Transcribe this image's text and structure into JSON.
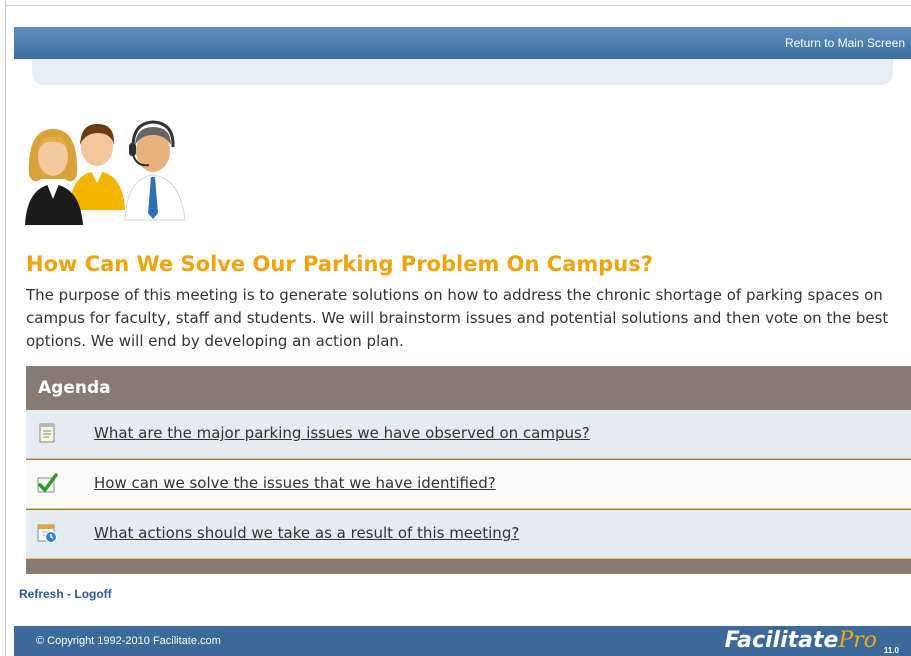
{
  "header": {
    "return_link": "Return to Main Screen"
  },
  "meeting": {
    "title": "How Can We Solve Our Parking Problem On Campus?",
    "description": "The purpose of this meeting is to generate solutions on how to address the chronic shortage of parking spaces on campus for faculty, staff and students. We will brainstorm issues and potential solutions and then vote on the best options. We will end by developing an action plan."
  },
  "agenda": {
    "title": "Agenda",
    "items": [
      {
        "label": "What are the major parking issues we have observed on campus?",
        "icon": "notepad-icon"
      },
      {
        "label": "How can we solve the issues that we have identified?",
        "icon": "checkmark-icon"
      },
      {
        "label": "What actions should we take as a result of this meeting?",
        "icon": "calendar-clock-icon"
      }
    ]
  },
  "footer": {
    "refresh": "Refresh",
    "separator": " - ",
    "logoff": "Logoff",
    "copyright": "© Copyright 1992-2010 Facilitate.com",
    "brand_main": "Facilitate",
    "brand_pro": "Pro",
    "brand_version": "11.0"
  },
  "colors": {
    "title": "#f0a30a",
    "header": "#3d6e9f",
    "agenda_bar": "#877a6f",
    "row_border": "#f0c45a"
  }
}
